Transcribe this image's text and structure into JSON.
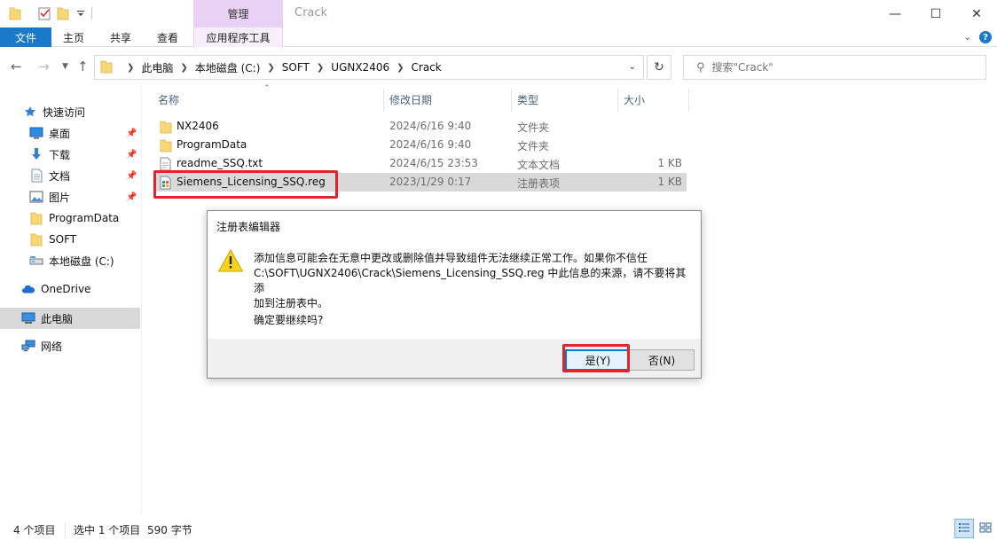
{
  "window": {
    "title": "Crack",
    "context_tab_group": "管理",
    "min_glyph": "—",
    "max_glyph": "☐",
    "close_glyph": "✕"
  },
  "ribbon": {
    "file": "文件",
    "home": "主页",
    "share": "共享",
    "view": "查看",
    "app_tools": "应用程序工具",
    "help_glyph": "?"
  },
  "address": {
    "crumbs": [
      "此电脑",
      "本地磁盘 (C:)",
      "SOFT",
      "UGNX2406",
      "Crack"
    ]
  },
  "search": {
    "placeholder": "搜索\"Crack\""
  },
  "sidebar": {
    "items": [
      {
        "label": "快速访问",
        "icon": "star-icon"
      },
      {
        "label": "桌面",
        "icon": "desktop-icon",
        "pinned": true
      },
      {
        "label": "下载",
        "icon": "download-icon",
        "pinned": true
      },
      {
        "label": "文档",
        "icon": "document-icon",
        "pinned": true
      },
      {
        "label": "图片",
        "icon": "picture-icon",
        "pinned": true
      },
      {
        "label": "ProgramData",
        "icon": "folder-icon"
      },
      {
        "label": "SOFT",
        "icon": "folder-icon"
      },
      {
        "label": "本地磁盘 (C:)",
        "icon": "drive-icon"
      },
      {
        "label": "OneDrive",
        "icon": "cloud-icon"
      },
      {
        "label": "此电脑",
        "icon": "computer-icon",
        "selected": true
      },
      {
        "label": "网络",
        "icon": "network-icon"
      }
    ]
  },
  "columns": {
    "name": "名称",
    "date": "修改日期",
    "type": "类型",
    "size": "大小"
  },
  "files": [
    {
      "name": "NX2406",
      "date": "2024/6/16 9:40",
      "type": "文件夹",
      "size": "",
      "icon": "folder-icon"
    },
    {
      "name": "ProgramData",
      "date": "2024/6/16 9:40",
      "type": "文件夹",
      "size": "",
      "icon": "folder-icon"
    },
    {
      "name": "readme_SSQ.txt",
      "date": "2024/6/15 23:53",
      "type": "文本文档",
      "size": "1 KB",
      "icon": "text-file-icon"
    },
    {
      "name": "Siemens_Licensing_SSQ.reg",
      "date": "2023/1/29 0:17",
      "type": "注册表项",
      "size": "1 KB",
      "icon": "registry-file-icon",
      "selected": true
    }
  ],
  "dialog": {
    "title": "注册表编辑器",
    "message_line1": "添加信息可能会在无意中更改或删除值并导致组件无法继续正常工作。如果你不信任",
    "message_line2": "C:\\SOFT\\UGNX2406\\Crack\\Siemens_Licensing_SSQ.reg 中此信息的来源，请不要将其添",
    "message_line3": "加到注册表中。",
    "question": "确定要继续吗?",
    "yes": "是(Y)",
    "no": "否(N)"
  },
  "status": {
    "item_count": "4 个项目",
    "selected": "选中 1 个项目",
    "size": "590 字节"
  }
}
